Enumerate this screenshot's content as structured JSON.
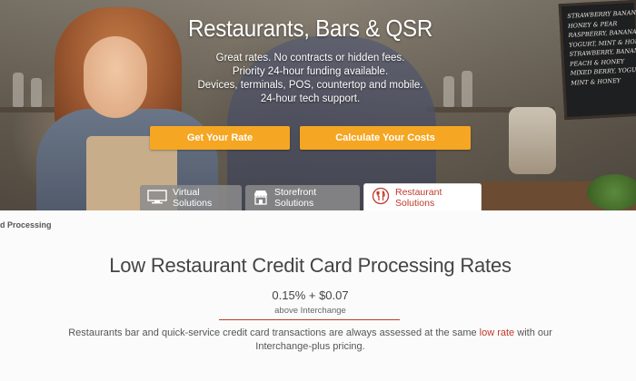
{
  "hero": {
    "title": "Restaurants, Bars & QSR",
    "lines": [
      "Great rates. No contracts or hidden fees.",
      "Priority 24-hour funding available.",
      "Devices, terminals, POS, countertop and mobile.",
      "24-hour tech support."
    ],
    "chalkboard_lines": [
      "STRAWBERRY BANANA,",
      "HONEY & PEAR",
      "RASPBERRY, BANANA,",
      "YOGURT, MINT & HONEY",
      "STRAWBERRY, BANANA,",
      "PEACH & HONEY",
      "MIXED BERRY, YOGURT,",
      "MINT & HONEY"
    ]
  },
  "buttons": {
    "get_rate": "Get Your Rate",
    "calculate": "Calculate Your Costs"
  },
  "tabs": [
    {
      "label": "Virtual Solutions",
      "icon": "monitor-icon",
      "active": false
    },
    {
      "label": "Storefront Solutions",
      "icon": "storefront-icon",
      "active": false
    },
    {
      "label": "Restaurant Solutions",
      "icon": "utensils-icon",
      "active": true
    }
  ],
  "breadcrumb": "d Processing",
  "content": {
    "title": "Low Restaurant Credit Card Processing Rates",
    "rate": "0.15% + $0.07",
    "rate_note": "above Interchange",
    "desc_before": "Restaurants bar and quick-service credit card transactions are always assessed at the same ",
    "desc_link": "low rate",
    "desc_after": " with our Interchange-plus pricing."
  },
  "colors": {
    "accent_orange": "#f5a623",
    "accent_red": "#c0392b",
    "tab_gray": "#8c8c8c"
  }
}
